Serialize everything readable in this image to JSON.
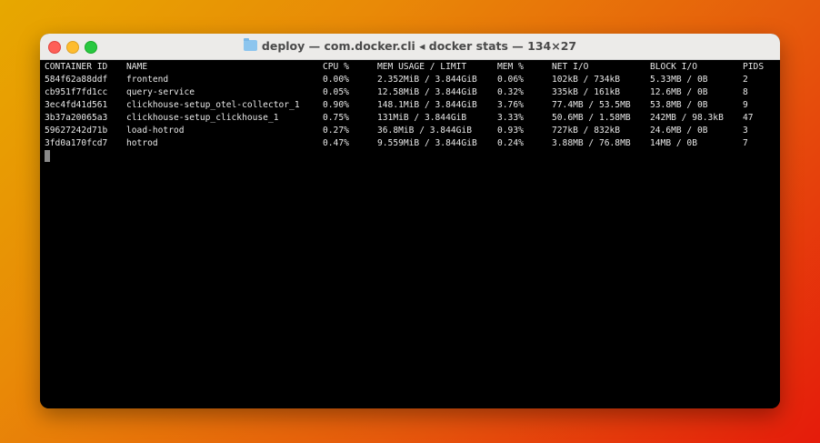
{
  "window": {
    "title": "deploy — com.docker.cli ◂ docker stats — 134×27",
    "title_icon": "folder-icon"
  },
  "table": {
    "headers": [
      "CONTAINER ID",
      "NAME",
      "CPU %",
      "MEM USAGE / LIMIT",
      "MEM %",
      "NET I/O",
      "BLOCK I/O",
      "PIDS"
    ],
    "rows": [
      [
        "584f62a88ddf",
        "frontend",
        "0.00%",
        "2.352MiB / 3.844GiB",
        "0.06%",
        "102kB / 734kB",
        "5.33MB / 0B",
        "2"
      ],
      [
        "cb951f7fd1cc",
        "query-service",
        "0.05%",
        "12.58MiB / 3.844GiB",
        "0.32%",
        "335kB / 161kB",
        "12.6MB / 0B",
        "8"
      ],
      [
        "3ec4fd41d561",
        "clickhouse-setup_otel-collector_1",
        "0.90%",
        "148.1MiB / 3.844GiB",
        "3.76%",
        "77.4MB / 53.5MB",
        "53.8MB / 0B",
        "9"
      ],
      [
        "3b37a20065a3",
        "clickhouse-setup_clickhouse_1",
        "0.75%",
        "131MiB / 3.844GiB",
        "3.33%",
        "50.6MB / 1.58MB",
        "242MB / 98.3kB",
        "47"
      ],
      [
        "59627242d71b",
        "load-hotrod",
        "0.27%",
        "36.8MiB / 3.844GiB",
        "0.93%",
        "727kB / 832kB",
        "24.6MB / 0B",
        "3"
      ],
      [
        "3fd0a170fcd7",
        "hotrod",
        "0.47%",
        "9.559MiB / 3.844GiB",
        "0.24%",
        "3.88MB / 76.8MB",
        "14MB / 0B",
        "7"
      ]
    ]
  }
}
